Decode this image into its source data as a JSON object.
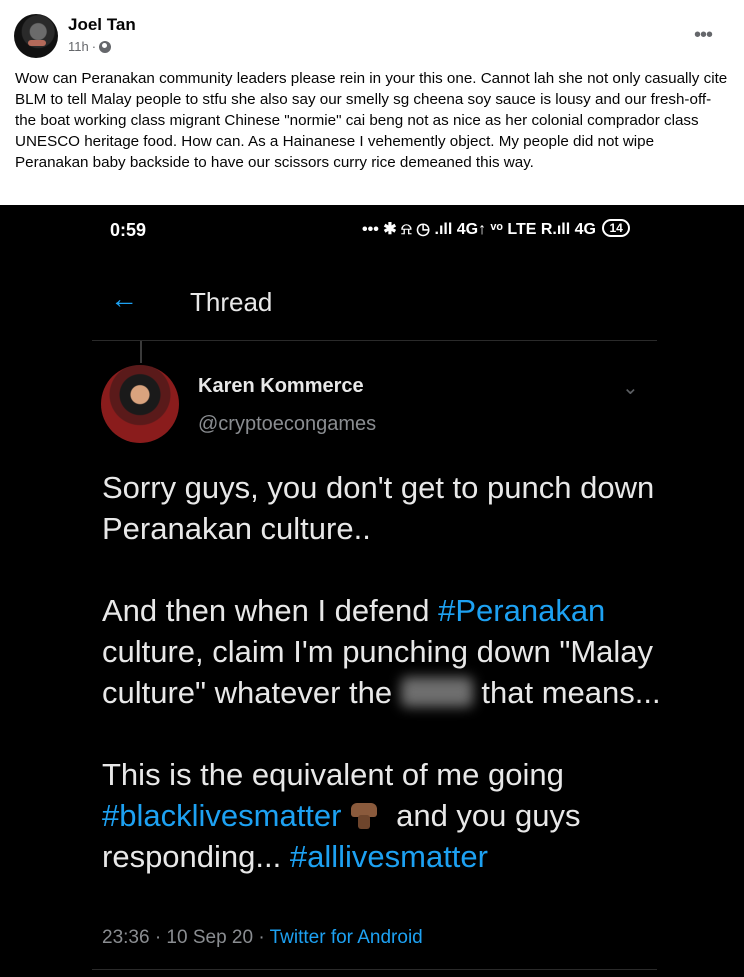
{
  "post": {
    "author": "Joel Tan",
    "time": "11h",
    "separator": "·",
    "text": "Wow can Peranakan community leaders please rein in your this one. Cannot lah she not only casually cite BLM to tell Malay people to stfu she also say our smelly sg cheena soy sauce is lousy and our fresh-off-the boat working class migrant Chinese \"normie\" cai beng not as nice as her colonial comprador class UNESCO heritage food. How can. As a Hainanese I vehemently object. My people did not wipe Peranakan baby backside to have our scissors curry rice demeaned this way.",
    "more_icon": "more-horizontal-icon",
    "privacy_icon": "globe-icon"
  },
  "screenshot": {
    "status_bar": {
      "time": "0:59",
      "icons": "••• ✱ ⍾ ◷ .ıll 4G↑ ᵛᵒ LTE R.ıll 4G",
      "battery": "14"
    },
    "header": {
      "back_icon": "←",
      "title": "Thread"
    },
    "tweet": {
      "display_name": "Karen Kommerce",
      "handle": "@cryptoecongames",
      "p1": "Sorry guys, you don't get to punch down Peranakan culture..",
      "p2_a": "And then when I defend ",
      "p2_tag": "#Peranakan",
      "p2_b": " culture, claim I'm punching down \"Malay culture\" whatever the ",
      "p2_c": " that means...",
      "p3_a": "This is the equivalent of me going ",
      "p3_tag1": "#blacklivesmatter",
      "p3_b": " and you guys responding... ",
      "p3_tag2": "#alllivesmatter",
      "timestamp": "23:36 · 10 Sep 20 · ",
      "source": "Twitter for Android"
    }
  },
  "colors": {
    "link_blue": "#1da1f2",
    "dark_bg": "#000000",
    "text_light": "#e8e8e8",
    "muted": "#8a8d91"
  }
}
